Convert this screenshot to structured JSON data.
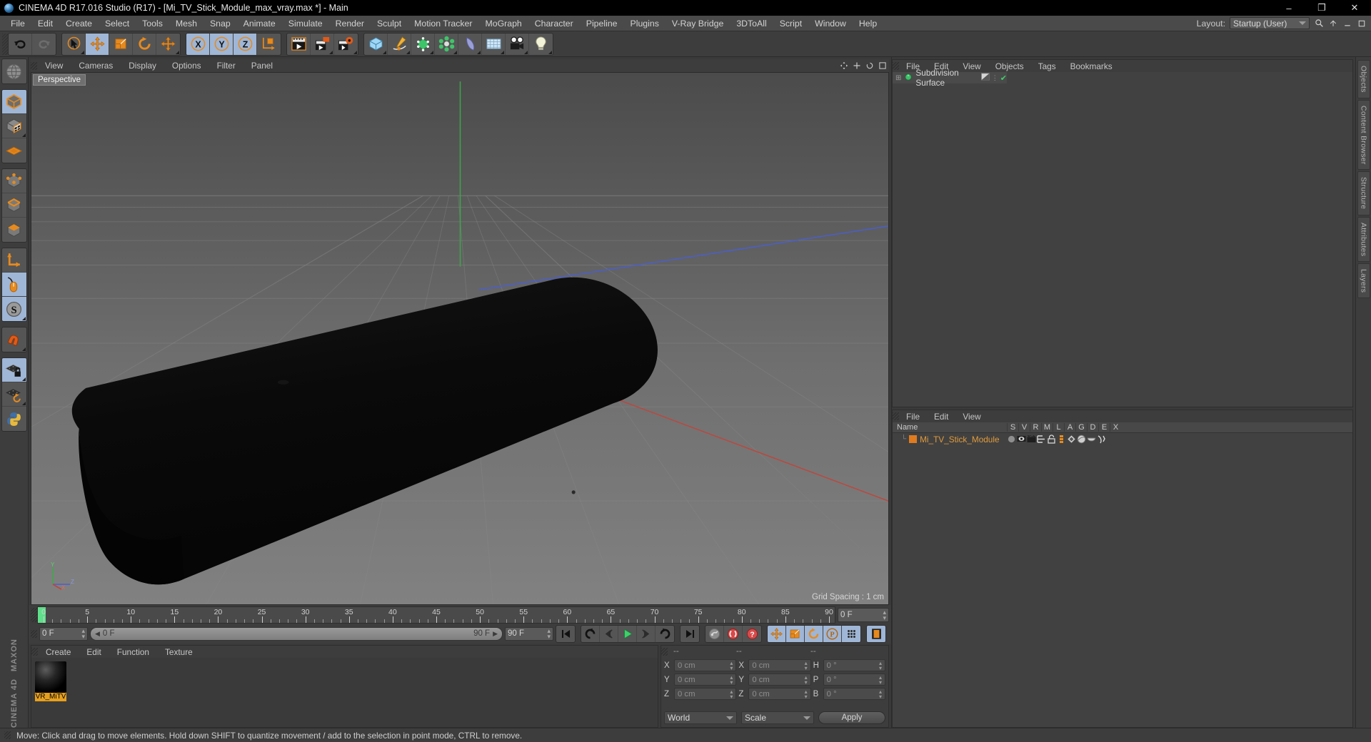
{
  "titlebar": {
    "text": "CINEMA 4D R17.016 Studio (R17) - [Mi_TV_Stick_Module_max_vray.max *] - Main",
    "minimize": "–",
    "maximize": "❐",
    "close": "✕"
  },
  "menubar": {
    "items": [
      "File",
      "Edit",
      "Create",
      "Select",
      "Tools",
      "Mesh",
      "Snap",
      "Animate",
      "Simulate",
      "Render",
      "Sculpt",
      "Motion Tracker",
      "MoGraph",
      "Character",
      "Pipeline",
      "Plugins",
      "V-Ray Bridge",
      "3DToAll",
      "Script",
      "Window",
      "Help"
    ],
    "layout_label": "Layout:",
    "layout_value": "Startup (User)",
    "search_icon": "search-icon"
  },
  "toolbar": {
    "groups": [
      {
        "name": "history",
        "buttons": [
          {
            "icon": "undo-icon",
            "label": "Undo",
            "selected": false,
            "corner": false
          },
          {
            "icon": "redo-icon",
            "label": "Redo",
            "selected": false,
            "corner": false
          }
        ]
      },
      {
        "name": "transform",
        "buttons": [
          {
            "icon": "select-live-icon",
            "label": "Live Selection",
            "selected": false,
            "corner": true
          },
          {
            "icon": "move-icon",
            "label": "Move",
            "selected": true,
            "corner": false
          },
          {
            "icon": "scale-icon",
            "label": "Scale",
            "selected": false,
            "corner": false
          },
          {
            "icon": "rotate-icon",
            "label": "Rotate",
            "selected": false,
            "corner": false
          },
          {
            "icon": "move-alt-icon",
            "label": "Move Tool Alt",
            "selected": false,
            "corner": true
          }
        ]
      },
      {
        "name": "axis-locks",
        "buttons": [
          {
            "icon": "axis-x-icon",
            "label": "X Axis",
            "selected": true,
            "corner": false
          },
          {
            "icon": "axis-y-icon",
            "label": "Y Axis",
            "selected": true,
            "corner": false
          },
          {
            "icon": "axis-z-icon",
            "label": "Z Axis",
            "selected": true,
            "corner": false
          },
          {
            "icon": "world-coord-icon",
            "label": "World/Object Coordinates",
            "selected": false,
            "corner": false
          }
        ]
      },
      {
        "name": "render",
        "buttons": [
          {
            "icon": "render-view-icon",
            "label": "Render View",
            "selected": false,
            "corner": false
          },
          {
            "icon": "render-picture-viewer-icon",
            "label": "Render to Picture Viewer",
            "selected": false,
            "corner": true
          },
          {
            "icon": "render-settings-icon",
            "label": "Edit Render Settings",
            "selected": false,
            "corner": true
          }
        ]
      },
      {
        "name": "create",
        "buttons": [
          {
            "icon": "cube-primitive-icon",
            "label": "Add Cube Object",
            "selected": false,
            "corner": true
          },
          {
            "icon": "spline-pen-icon",
            "label": "Add Spline",
            "selected": false,
            "corner": true
          },
          {
            "icon": "nurbs-icon",
            "label": "Add Generator",
            "selected": false,
            "corner": true
          },
          {
            "icon": "array-icon",
            "label": "Add Modeling Object",
            "selected": false,
            "corner": true
          },
          {
            "icon": "bend-deformer-icon",
            "label": "Add Bend Object",
            "selected": false,
            "corner": true
          },
          {
            "icon": "floor-environment-icon",
            "label": "Add Floor Object",
            "selected": false,
            "corner": true
          },
          {
            "icon": "camera-icon",
            "label": "Add Camera Object",
            "selected": false,
            "corner": true
          },
          {
            "icon": "light-icon",
            "label": "Add Light Object",
            "selected": false,
            "corner": true
          }
        ]
      }
    ]
  },
  "leftbar": {
    "groups": [
      {
        "buttons": [
          {
            "icon": "make-editable-icon",
            "label": "Make Editable",
            "selected": false
          }
        ]
      },
      {
        "buttons": [
          {
            "icon": "model-mode-icon",
            "label": "Model Mode",
            "selected": true
          },
          {
            "icon": "texture-mode-icon",
            "label": "Texture Mode",
            "selected": false
          },
          {
            "icon": "workplane-mode-icon",
            "label": "Workplane Mode",
            "selected": false
          }
        ]
      },
      {
        "buttons": [
          {
            "icon": "points-mode-icon",
            "label": "Points Mode",
            "selected": false
          },
          {
            "icon": "edges-mode-icon",
            "label": "Edges Mode",
            "selected": false
          },
          {
            "icon": "polygons-mode-icon",
            "label": "Polygons Mode",
            "selected": false
          }
        ]
      },
      {
        "buttons": [
          {
            "icon": "axis-modify-icon",
            "label": "Enable Axis Modification",
            "selected": false
          },
          {
            "icon": "viewport-solo-icon",
            "label": "Enable Viewport Solo",
            "selected": true
          },
          {
            "icon": "snap-s-icon",
            "label": "Enable Snapping",
            "selected": true
          }
        ]
      },
      {
        "buttons": [
          {
            "icon": "magnet-icon",
            "label": "Magnet",
            "selected": false
          }
        ]
      },
      {
        "buttons": [
          {
            "icon": "lock-workplane-icon",
            "label": "Lock Workplane",
            "selected": true
          },
          {
            "icon": "planar-workplane-icon",
            "label": "Planar Workplane",
            "selected": false
          },
          {
            "icon": "python-icon",
            "label": "Python Script",
            "selected": false
          }
        ]
      }
    ],
    "brand_top": "MAXON",
    "brand_bottom": "CINEMA 4D"
  },
  "viewport": {
    "menu": [
      "View",
      "Cameras",
      "Display",
      "Options",
      "Filter",
      "Panel"
    ],
    "label": "Perspective",
    "grid_spacing": "Grid Spacing : 1 cm",
    "axis_labels": {
      "x": "X",
      "y": "Y",
      "z": "Z"
    },
    "header_icons": [
      "pan-view-icon",
      "zoom-view-icon",
      "rotate-view-icon",
      "maximize-view-icon"
    ]
  },
  "timeline": {
    "ticks": [
      0,
      5,
      10,
      15,
      20,
      25,
      30,
      35,
      40,
      45,
      50,
      55,
      60,
      65,
      70,
      75,
      80,
      85,
      90
    ],
    "min_frame": 0,
    "max_frame": 90,
    "current_frame_label": "0 F"
  },
  "transport": {
    "current_frame": "0 F",
    "range_start": "0 F",
    "range_end": "90 F",
    "preview_end": "90 F",
    "buttons": [
      {
        "icon": "go-to-start-icon",
        "label": "Go to Start",
        "selected": false
      },
      {
        "icon": "rewind-icon",
        "label": "Play Backwards",
        "selected": false
      },
      {
        "icon": "step-back-icon",
        "label": "Go to Previous Frame",
        "selected": false
      },
      {
        "icon": "play-icon",
        "label": "Play Forwards",
        "selected": false
      },
      {
        "icon": "step-forward-icon",
        "label": "Go to Next Frame",
        "selected": false
      },
      {
        "icon": "forward-icon",
        "label": "Go Forward",
        "selected": false
      },
      {
        "icon": "go-to-end-icon",
        "label": "Go to End",
        "selected": false
      },
      {
        "icon": "record-key-icon",
        "label": "Record Active Objects",
        "selected": false
      },
      {
        "icon": "autokey-icon",
        "label": "Autokeying",
        "selected": false
      },
      {
        "icon": "keyframe-select-icon",
        "label": "Keyframe Selection",
        "selected": false
      },
      {
        "icon": "position-key-icon",
        "label": "Position",
        "selected": true
      },
      {
        "icon": "scale-key-icon",
        "label": "Scale",
        "selected": true
      },
      {
        "icon": "rotation-key-icon",
        "label": "Rotation",
        "selected": true
      },
      {
        "icon": "param-key-icon",
        "label": "Parameter",
        "selected": true
      },
      {
        "icon": "pla-key-icon",
        "label": "Point Level Animation",
        "selected": true
      },
      {
        "icon": "timeline-icon",
        "label": "Timeline",
        "selected": true
      }
    ]
  },
  "material_manager": {
    "menu": [
      "Create",
      "Edit",
      "Function",
      "Texture"
    ],
    "materials": [
      {
        "name": "VR_MiTV",
        "full_name": "VR_MiTV"
      }
    ]
  },
  "coordinates": {
    "headers": [
      "--",
      "--",
      "--"
    ],
    "rows": [
      {
        "a_axis": "X",
        "a_val": "0 cm",
        "b_axis": "X",
        "b_val": "0 cm",
        "c_axis": "H",
        "c_val": "0 °"
      },
      {
        "a_axis": "Y",
        "a_val": "0 cm",
        "b_axis": "Y",
        "b_val": "0 cm",
        "c_axis": "P",
        "c_val": "0 °"
      },
      {
        "a_axis": "Z",
        "a_val": "0 cm",
        "b_axis": "Z",
        "b_val": "0 cm",
        "c_axis": "B",
        "c_val": "0 °"
      }
    ],
    "system": "World",
    "mode": "Scale",
    "apply": "Apply"
  },
  "object_manager_top": {
    "menu": [
      "File",
      "Edit",
      "View",
      "Objects",
      "Tags",
      "Bookmarks"
    ],
    "rows": [
      {
        "name": "Subdivision Surface",
        "icon": "subdivision-surface-icon",
        "checked": true
      }
    ]
  },
  "object_manager_bottom": {
    "menu": [
      "File",
      "Edit",
      "View"
    ],
    "name_column": "Name",
    "columns": [
      "S",
      "V",
      "R",
      "M",
      "L",
      "A",
      "G",
      "D",
      "E",
      "X"
    ],
    "rows": [
      {
        "name": "Mi_TV_Stick_Module",
        "color": "#e07b1e",
        "tags": [
          "dot-tag-icon",
          "visibility-tag-icon",
          "render-tag-icon",
          "layer-tag-icon",
          "lock-tag-icon",
          "list-tag-icon",
          "xpresso-tag-icon",
          "phong-tag-icon",
          "display-tag-icon",
          "deform-tag-icon"
        ]
      }
    ]
  },
  "right_tabs": [
    "Objects",
    "Content Browser",
    "Structure",
    "Attributes",
    "Layers"
  ],
  "statusbar": {
    "text": "Move: Click and drag to move elements. Hold down SHIFT to quantize movement / add to the selection in point mode, CTRL to remove."
  },
  "colors": {
    "accent_orange": "#e68a1e",
    "selection_blue": "#9fb6d6",
    "panel_bg": "#3d3d3d",
    "viewport_top": "#4c4c4c",
    "viewport_bottom": "#7d7d7d",
    "playhead_green": "#5fdf8a",
    "axis_x_red": "#c2443a",
    "axis_y_green": "#3fa84a",
    "axis_z_blue": "#4a5fd0"
  }
}
